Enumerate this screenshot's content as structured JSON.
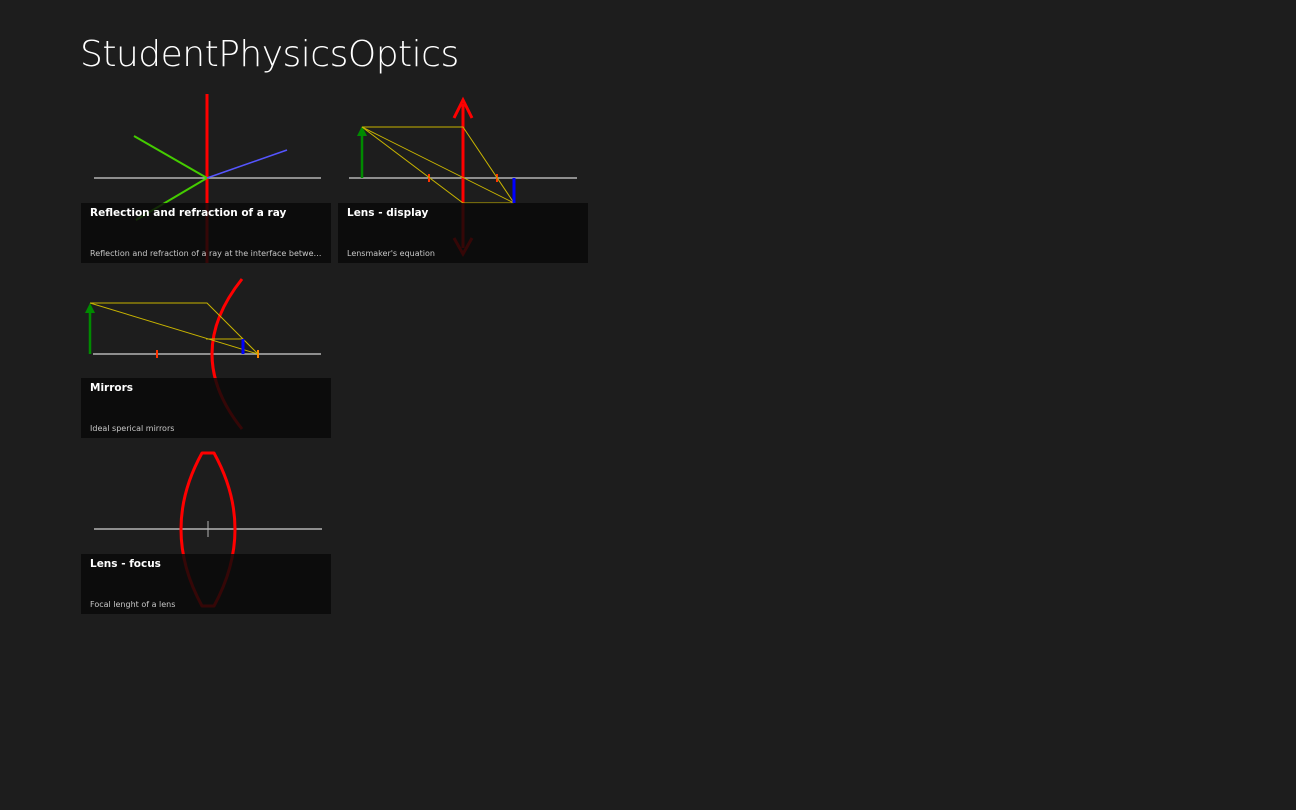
{
  "app": {
    "title": "StudentPhysicsOptics"
  },
  "tiles": [
    {
      "title": "Reflection and refraction of a ray",
      "subtitle": "Reflection and refraction of a ray at the interface between two..."
    },
    {
      "title": "Lens - display",
      "subtitle": "Lensmaker's equation"
    },
    {
      "title": "Mirrors",
      "subtitle": "Ideal sperical mirrors"
    },
    {
      "title": "Lens - focus",
      "subtitle": "Focal lenght of a lens"
    }
  ],
  "colors": {
    "background": "#1d1d1d",
    "caption_bg": "#080808",
    "axis": "#b4b4b4",
    "normal_line": "#ff0000",
    "incident_ray": "#44cc00",
    "refracted_ray": "#5555ff",
    "object_arrow": "#008a00",
    "image_arrow": "#0000ff",
    "construction_ray": "#c8b400",
    "lens": "#ff0000"
  }
}
